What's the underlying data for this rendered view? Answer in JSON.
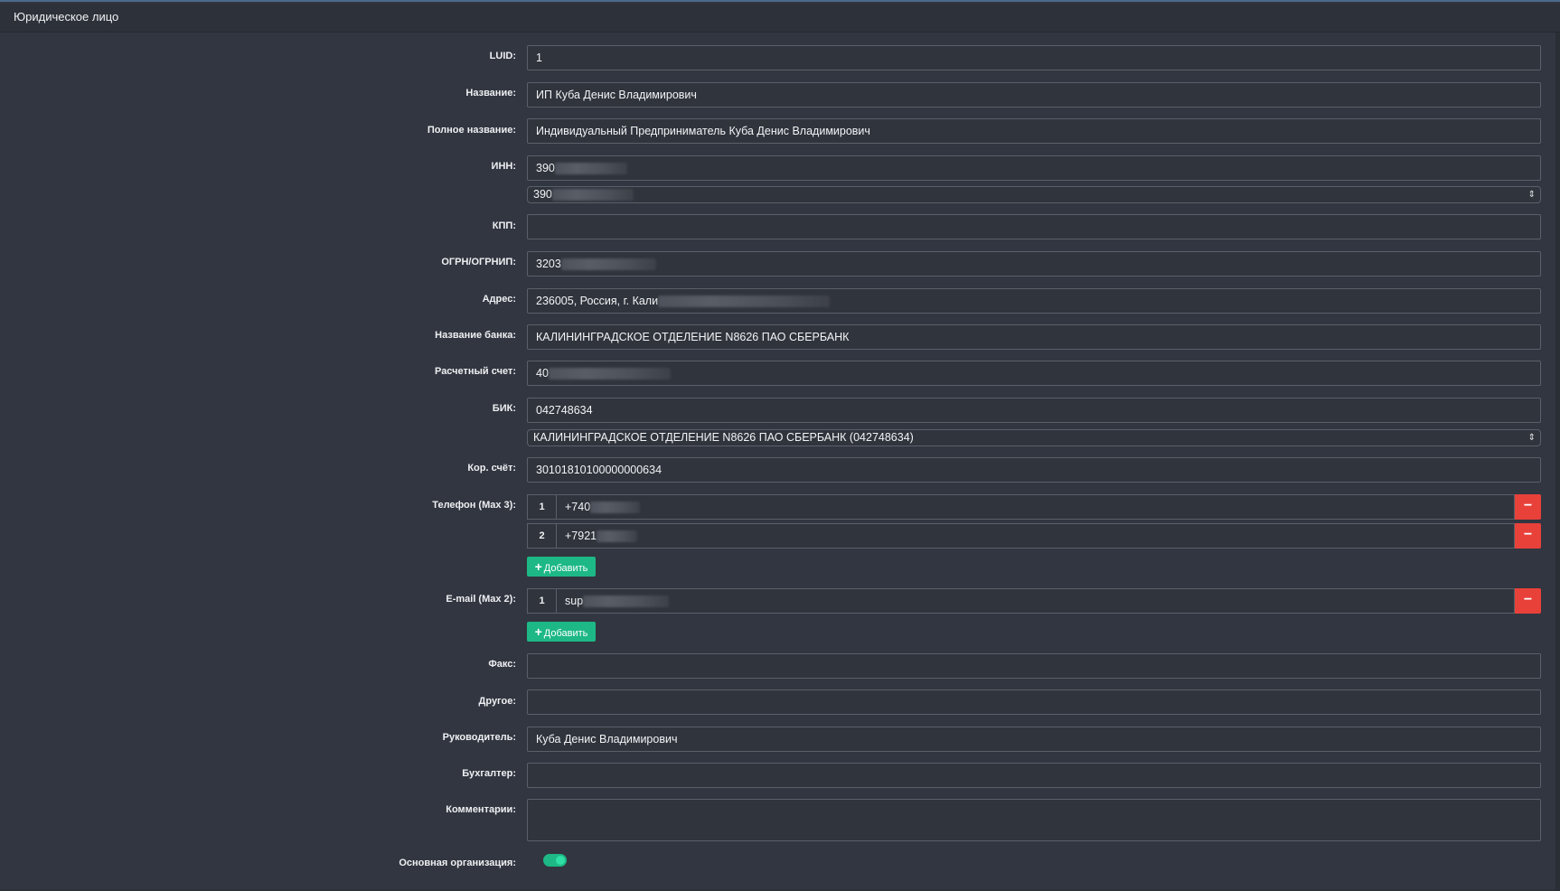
{
  "panel": {
    "title": "Юридическое лицо"
  },
  "form": {
    "luid": {
      "label": "LUID:",
      "value": "1"
    },
    "name": {
      "label": "Название:",
      "value": "ИП Куба Денис Владимирович"
    },
    "full_name": {
      "label": "Полное название:",
      "value": "Индивидуальный Предприниматель Куба Денис Владимирович"
    },
    "inn": {
      "label": "ИНН:",
      "value": "390",
      "select_value": "390"
    },
    "kpp": {
      "label": "КПП:",
      "value": ""
    },
    "ogrn": {
      "label": "ОГРН/ОГРНИП:",
      "value": "3203"
    },
    "address": {
      "label": "Адрес:",
      "value": "236005, Россия, г. Кали"
    },
    "bank_name": {
      "label": "Название банка:",
      "value": "КАЛИНИНГРАДСКОЕ ОТДЕЛЕНИЕ N8626 ПАО СБЕРБАНК"
    },
    "account": {
      "label": "Расчетный счет:",
      "value": "40"
    },
    "bik": {
      "label": "БИК:",
      "value": "042748634",
      "select_value": "КАЛИНИНГРАДСКОЕ ОТДЕЛЕНИЕ N8626 ПАО СБЕРБАНК (042748634)"
    },
    "kor_account": {
      "label": "Кор. счёт:",
      "value": "30101810100000000634"
    },
    "phones": {
      "label": "Телефон (Max 3):",
      "items": [
        {
          "num": "1",
          "value": "+740"
        },
        {
          "num": "2",
          "value": "+7921"
        }
      ],
      "add_label": "Добавить"
    },
    "emails": {
      "label": "E-mail (Max 2):",
      "items": [
        {
          "num": "1",
          "value": "sup"
        }
      ],
      "add_label": "Добавить"
    },
    "fax": {
      "label": "Факс:",
      "value": ""
    },
    "other": {
      "label": "Другое:",
      "value": ""
    },
    "director": {
      "label": "Руководитель:",
      "value": "Куба Денис Владимирович"
    },
    "accountant": {
      "label": "Бухгалтер:",
      "value": ""
    },
    "comments": {
      "label": "Комментарии:",
      "value": ""
    },
    "main_org": {
      "label": "Основная организация:",
      "enabled": true
    }
  },
  "icons": {
    "remove": "minus-icon",
    "add": "plus-icon",
    "select": "chevron-updown-icon"
  },
  "colors": {
    "accent": "#1db885",
    "danger": "#e8413a",
    "background": "#323640"
  }
}
